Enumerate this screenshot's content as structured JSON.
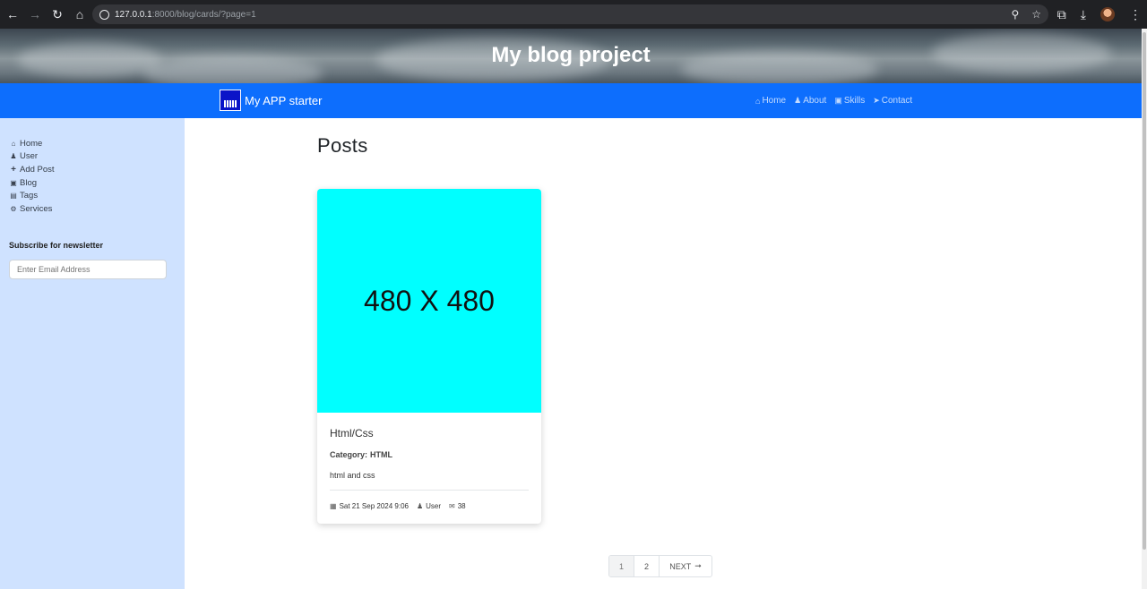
{
  "browser": {
    "url_host": "127.0.0.1",
    "url_rest": ":8000/blog/cards/?page=1"
  },
  "hero": {
    "title": "My blog project"
  },
  "navbar": {
    "brand": "My APP starter",
    "links": [
      {
        "label": "Home",
        "icon": "home-icon"
      },
      {
        "label": "About",
        "icon": "user-icon"
      },
      {
        "label": "Skills",
        "icon": "book-icon"
      },
      {
        "label": "Contact",
        "icon": "paper-plane-icon"
      }
    ]
  },
  "sidebar": {
    "items": [
      {
        "label": "Home",
        "icon": "home-icon"
      },
      {
        "label": "User",
        "icon": "user-icon"
      },
      {
        "label": "Add Post",
        "icon": "plus-icon"
      },
      {
        "label": "Blog",
        "icon": "book-icon"
      },
      {
        "label": "Tags",
        "icon": "briefcase-icon"
      },
      {
        "label": "Services",
        "icon": "cogs-icon"
      }
    ],
    "newsletter_title": "Subscribe for newsletter",
    "email_placeholder": "Enter Email Address"
  },
  "main": {
    "heading": "Posts",
    "posts": [
      {
        "image_text": "480 X 480",
        "title": "Html/Css",
        "category_label": "Category:",
        "category": "HTML",
        "description": "html and css",
        "date": "Sat 21 Sep 2024 9:06",
        "author": "User",
        "comments": "38"
      }
    ],
    "pagination": {
      "pages": [
        "1",
        "2"
      ],
      "next_label": "NEXT"
    }
  },
  "colors": {
    "navbar": "#0d6efd",
    "sidebar": "#cfe2ff",
    "card_image": "#00ffff"
  }
}
